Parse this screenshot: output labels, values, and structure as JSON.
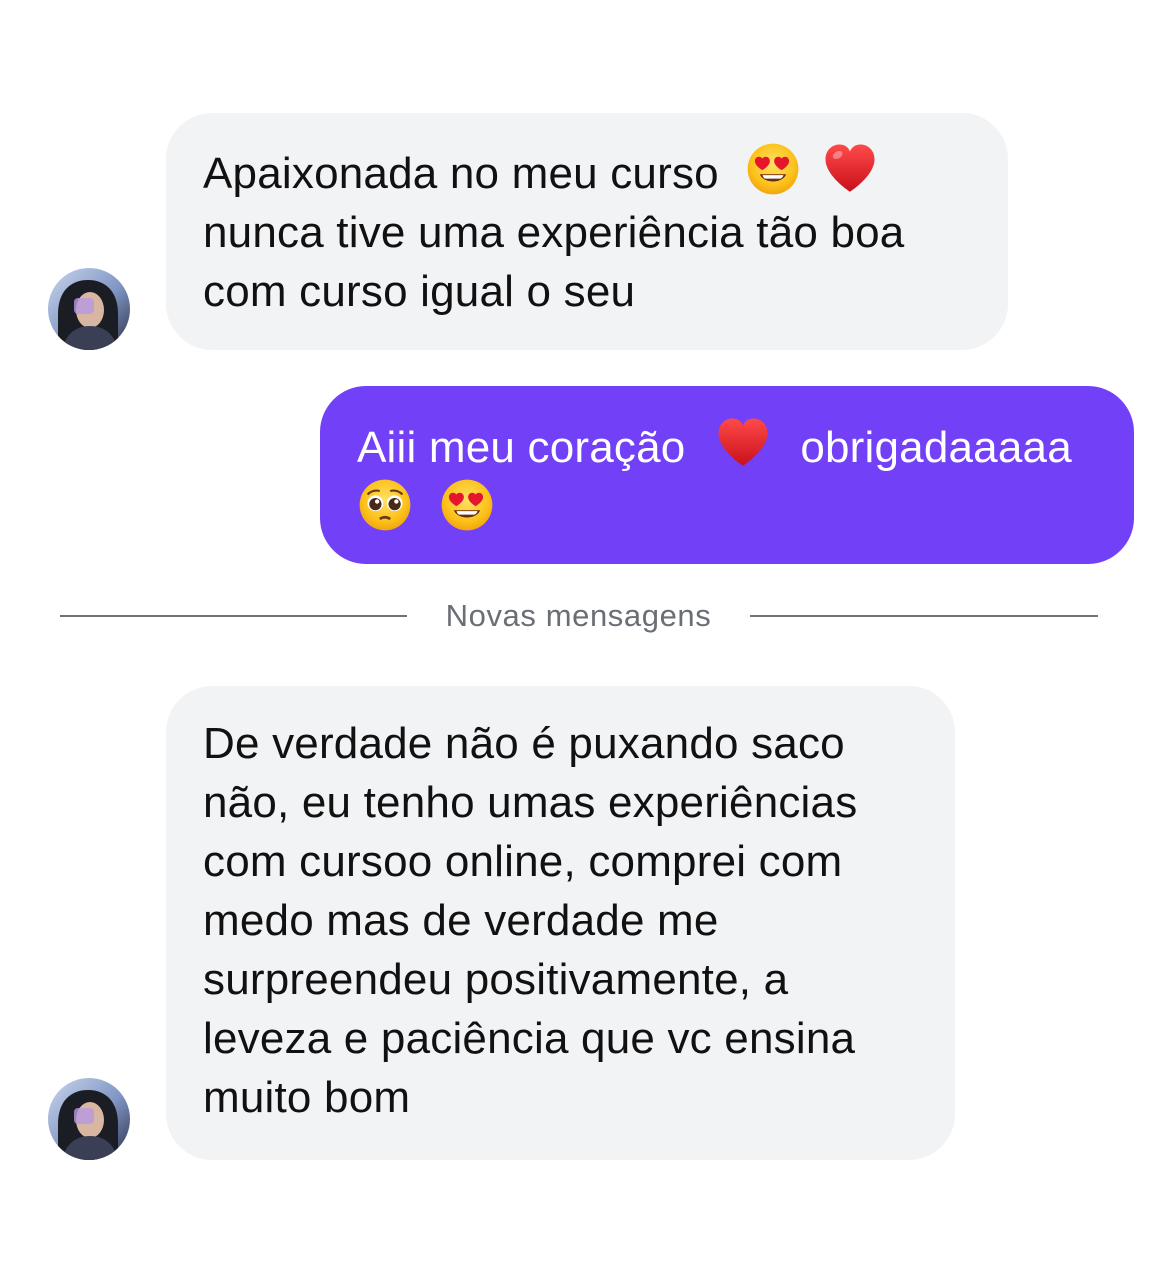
{
  "colors": {
    "incoming_bubble": "#f2f3f5",
    "outgoing_bubble": "#7140f7",
    "divider": "#6f747b"
  },
  "messages": [
    {
      "direction": "incoming",
      "avatar_icon": "profile-photo",
      "lines": [
        "Apaixonada no meu curso",
        "nunca tive uma experiência tão boa",
        "com curso igual o seu"
      ],
      "emojis": [
        "heart-eyes-emoji-icon",
        "red-heart-emoji-icon"
      ]
    },
    {
      "direction": "outgoing",
      "lines": [
        "Aiii meu coração",
        "obrigadaaaaa"
      ],
      "emojis": [
        "red-heart-emoji-icon",
        "pleading-face-emoji-icon",
        "heart-eyes-emoji-icon"
      ]
    },
    {
      "direction": "incoming",
      "avatar_icon": "profile-photo",
      "lines": [
        "De verdade não é puxando saco",
        "não, eu tenho umas experiências",
        "com cursoo online, comprei com",
        "medo mas de verdade me",
        "surpreendeu positivamente, a",
        "leveza e paciência que vc ensina",
        "muito bom"
      ]
    }
  ],
  "divider": {
    "label": "Novas mensagens"
  }
}
